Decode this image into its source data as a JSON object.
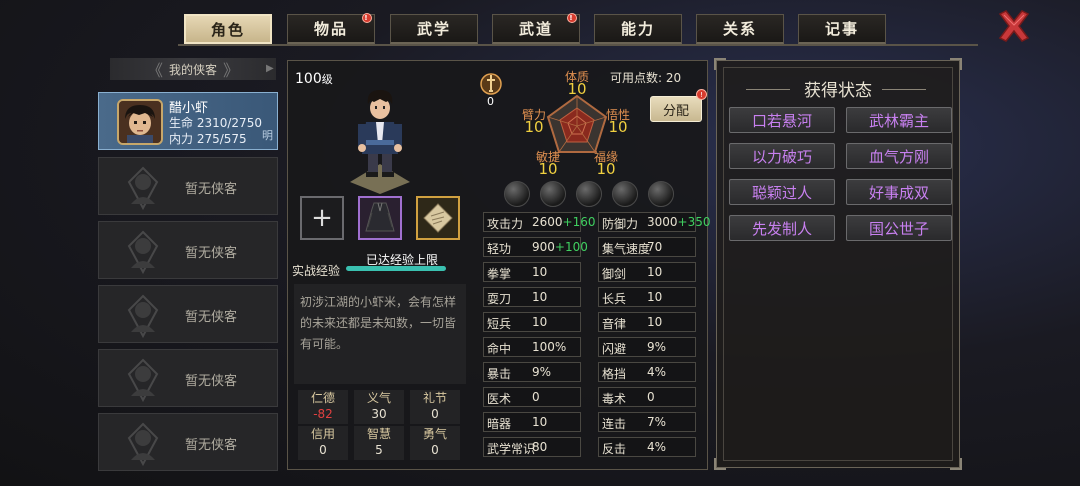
{
  "tabs": [
    {
      "label": "角色",
      "active": true,
      "badge": false
    },
    {
      "label": "物品",
      "active": false,
      "badge": true
    },
    {
      "label": "武学",
      "active": false,
      "badge": false
    },
    {
      "label": "武道",
      "active": false,
      "badge": true
    },
    {
      "label": "能力",
      "active": false,
      "badge": false
    },
    {
      "label": "关系",
      "active": false,
      "badge": false
    },
    {
      "label": "记事",
      "active": false,
      "badge": false
    }
  ],
  "badge_mark": "!",
  "close_icon": "close-x-icon",
  "roster": {
    "header": "我的侠客",
    "arrow_left": "《",
    "arrow_right": "》",
    "active_hero": {
      "name": "醋小虾",
      "hp_label": "生命",
      "hp_value": "2310/2750",
      "mp_label": "内力",
      "mp_value": "275/575",
      "mode": "明"
    },
    "empty_label": "暂无侠客",
    "empty_count": 5
  },
  "character": {
    "level": "100",
    "level_unit": "级",
    "sword_value": "0",
    "add_slot_symbol": "+",
    "exp_label": "实战经验",
    "exp_status": "已达经验上限",
    "exp_fraction": 1.0,
    "description": "初涉江湖的小虾米，会有怎样的未来还都是未知数，一切皆有可能。",
    "virtues": [
      {
        "name": "仁德",
        "value": "-82",
        "negative": true
      },
      {
        "name": "义气",
        "value": "30",
        "negative": false
      },
      {
        "name": "礼节",
        "value": "0",
        "negative": false
      },
      {
        "name": "信用",
        "value": "0",
        "negative": false
      },
      {
        "name": "智慧",
        "value": "5",
        "negative": false
      },
      {
        "name": "勇气",
        "value": "0",
        "negative": false
      }
    ]
  },
  "radar": {
    "attrs": [
      {
        "name": "体质",
        "value": "10"
      },
      {
        "name": "臂力",
        "value": "10"
      },
      {
        "name": "悟性",
        "value": "10"
      },
      {
        "name": "敏捷",
        "value": "10"
      },
      {
        "name": "福缘",
        "value": "10"
      }
    ],
    "points_label": "可用点数:",
    "points_value": "20",
    "assign_label": "分配"
  },
  "stats_left": [
    {
      "name": "攻击力",
      "value": "2600",
      "bonus": "+160"
    },
    {
      "name": "轻功",
      "value": "900",
      "bonus": "+100"
    },
    {
      "name": "拳掌",
      "value": "10",
      "bonus": ""
    },
    {
      "name": "耍刀",
      "value": "10",
      "bonus": ""
    },
    {
      "name": "短兵",
      "value": "10",
      "bonus": ""
    },
    {
      "name": "命中",
      "value": "100%",
      "bonus": ""
    },
    {
      "name": "暴击",
      "value": "9%",
      "bonus": ""
    },
    {
      "name": "医术",
      "value": "0",
      "bonus": ""
    },
    {
      "name": "暗器",
      "value": "10",
      "bonus": ""
    },
    {
      "name": "武学常识",
      "value": "80",
      "bonus": ""
    }
  ],
  "stats_right": [
    {
      "name": "防御力",
      "value": "3000",
      "bonus": "+350"
    },
    {
      "name": "集气速度",
      "value": "70",
      "bonus": ""
    },
    {
      "name": "御剑",
      "value": "10",
      "bonus": ""
    },
    {
      "name": "长兵",
      "value": "10",
      "bonus": ""
    },
    {
      "name": "音律",
      "value": "10",
      "bonus": ""
    },
    {
      "name": "闪避",
      "value": "9%",
      "bonus": ""
    },
    {
      "name": "格挡",
      "value": "4%",
      "bonus": ""
    },
    {
      "name": "毒术",
      "value": "0",
      "bonus": ""
    },
    {
      "name": "连击",
      "value": "7%",
      "bonus": ""
    },
    {
      "name": "反击",
      "value": "4%",
      "bonus": ""
    }
  ],
  "status_panel": {
    "title": "获得状态",
    "items": [
      "口若悬河",
      "武林霸主",
      "以力破巧",
      "血气方刚",
      "聪颖过人",
      "好事成双",
      "先发制人",
      "国公世子"
    ]
  },
  "colors": {
    "status_text": "#c880f0",
    "radar_label": "#e09050",
    "radar_value": "#f0d040",
    "bonus": "#40d060",
    "negative": "#e04040",
    "exp_bar": "#3ac0b0"
  }
}
